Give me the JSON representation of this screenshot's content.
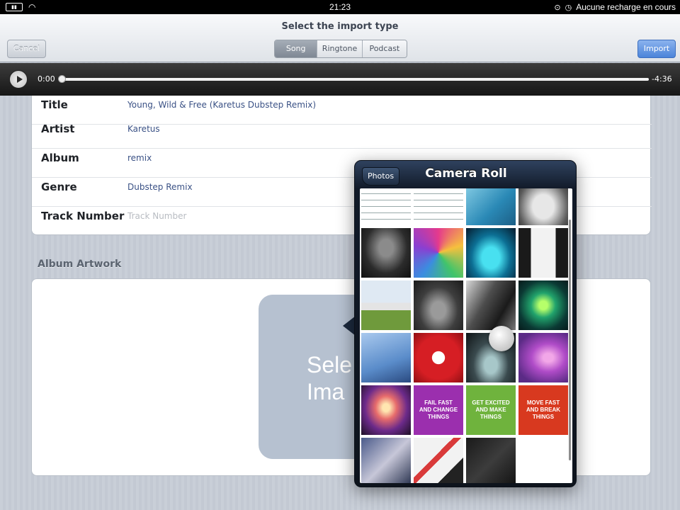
{
  "status_bar": {
    "time": "21:23",
    "charge_status": "Aucune recharge en cours"
  },
  "nav": {
    "title": "Select the import type",
    "cancel_label": "Cancel",
    "import_label": "Import",
    "segments": [
      "Song",
      "Ringtone",
      "Podcast"
    ],
    "selected_segment": "Song"
  },
  "player": {
    "elapsed": "0:00",
    "remaining": "-4:36",
    "progress": 0
  },
  "metadata": [
    {
      "label": "Title",
      "value": "Young, Wild & Free (Karetus Dubstep Remix)",
      "placeholder": false
    },
    {
      "label": "Artist",
      "value": "Karetus",
      "placeholder": false
    },
    {
      "label": "Album",
      "value": "remix",
      "placeholder": false
    },
    {
      "label": "Genre",
      "value": "Dubstep Remix",
      "placeholder": false
    },
    {
      "label": "Track Number",
      "value": "Track Number",
      "placeholder": true
    }
  ],
  "artwork": {
    "heading": "Album Artwork",
    "select_text_line1": "Sele",
    "select_text_line2": "Ima"
  },
  "popover": {
    "title": "Camera Roll",
    "back_label": "Photos",
    "thumb_texts": {
      "fail_fast": "FAIL FAST AND CHANGE THINGS",
      "get_excited": "GET EXCITED AND MAKE THINGS",
      "move_fast": "MOVE FAST AND BREAK THINGS"
    }
  }
}
